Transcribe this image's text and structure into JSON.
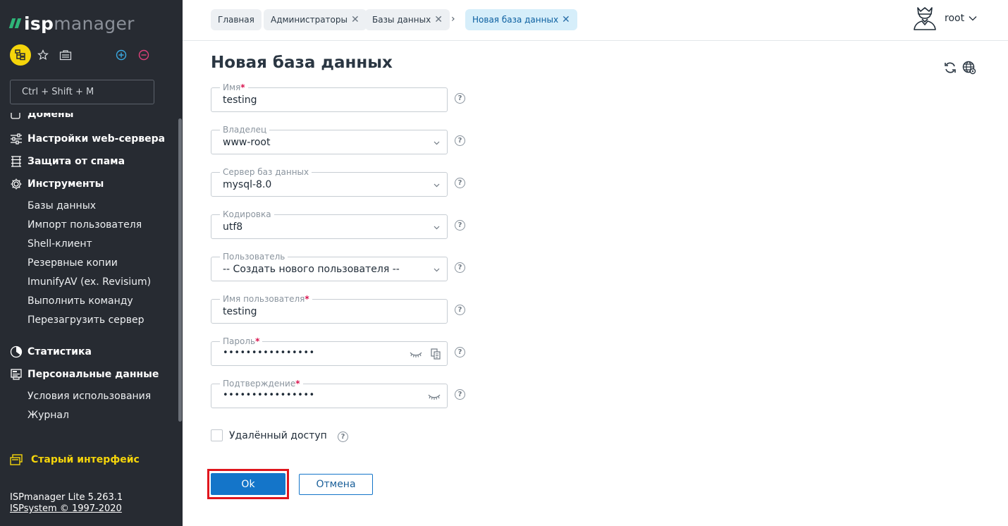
{
  "sidebar": {
    "logo_isp": "isp",
    "logo_manager": "manager",
    "search": {
      "placeholder": "Ctrl + Shift + M",
      "value": ""
    },
    "partial_item": "Домены",
    "groups": [
      {
        "label": "Настройки web-сервера",
        "icon": "sliders-icon"
      },
      {
        "label": "Защита от спама",
        "icon": "spam-filter-icon"
      },
      {
        "label": "Инструменты",
        "icon": "gear-icon"
      }
    ],
    "tools_items": [
      "Базы данных",
      "Импорт пользователя",
      "Shell-клиент",
      "Резервные копии",
      "ImunifyAV (ex. Revisium)",
      "Выполнить команду",
      "Перезагрузить сервер"
    ],
    "stats_label": "Статистика",
    "personal_label": "Персональные данные",
    "personal_items": [
      "Условия использования",
      "Журнал"
    ],
    "old_ui_label": "Старый интерфейс",
    "version": "ISPmanager Lite 5.263.1",
    "copyright": "ISPsystem © 1997-2020"
  },
  "breadcrumbs": {
    "home": "Главная",
    "admins": "Администраторы",
    "databases": "Базы данных",
    "separator": "›",
    "current": "Новая база данных"
  },
  "user": {
    "name": "root"
  },
  "form": {
    "title": "Новая база данных",
    "fields": {
      "name": {
        "label": "Имя",
        "required": "*",
        "value": "testing"
      },
      "owner": {
        "label": "Владелец",
        "value": "www-root"
      },
      "db_server": {
        "label": "Сервер баз данных",
        "value": "mysql-8.0"
      },
      "encoding": {
        "label": "Кодировка",
        "value": "utf8"
      },
      "user": {
        "label": "Пользователь",
        "value": "-- Создать нового пользователя --"
      },
      "username": {
        "label": "Имя пользователя",
        "required": "*",
        "value": "testing"
      },
      "password": {
        "label": "Пароль",
        "required": "*",
        "value": "••••••••••••••••"
      },
      "confirm": {
        "label": "Подтверждение",
        "required": "*",
        "value": "••••••••••••••••"
      }
    },
    "remote_access": {
      "label": "Удалённый доступ",
      "checked": false
    },
    "help_glyph": "?",
    "ok_label": "Ok",
    "cancel_label": "Отмена"
  },
  "colors": {
    "sidebar_bg": "#272b32",
    "accent_yellow": "#f5d50b",
    "logo_green": "#2fb478",
    "primary_blue": "#1475c9",
    "required_red": "#d8124d",
    "highlight_frame": "#e0161d"
  }
}
